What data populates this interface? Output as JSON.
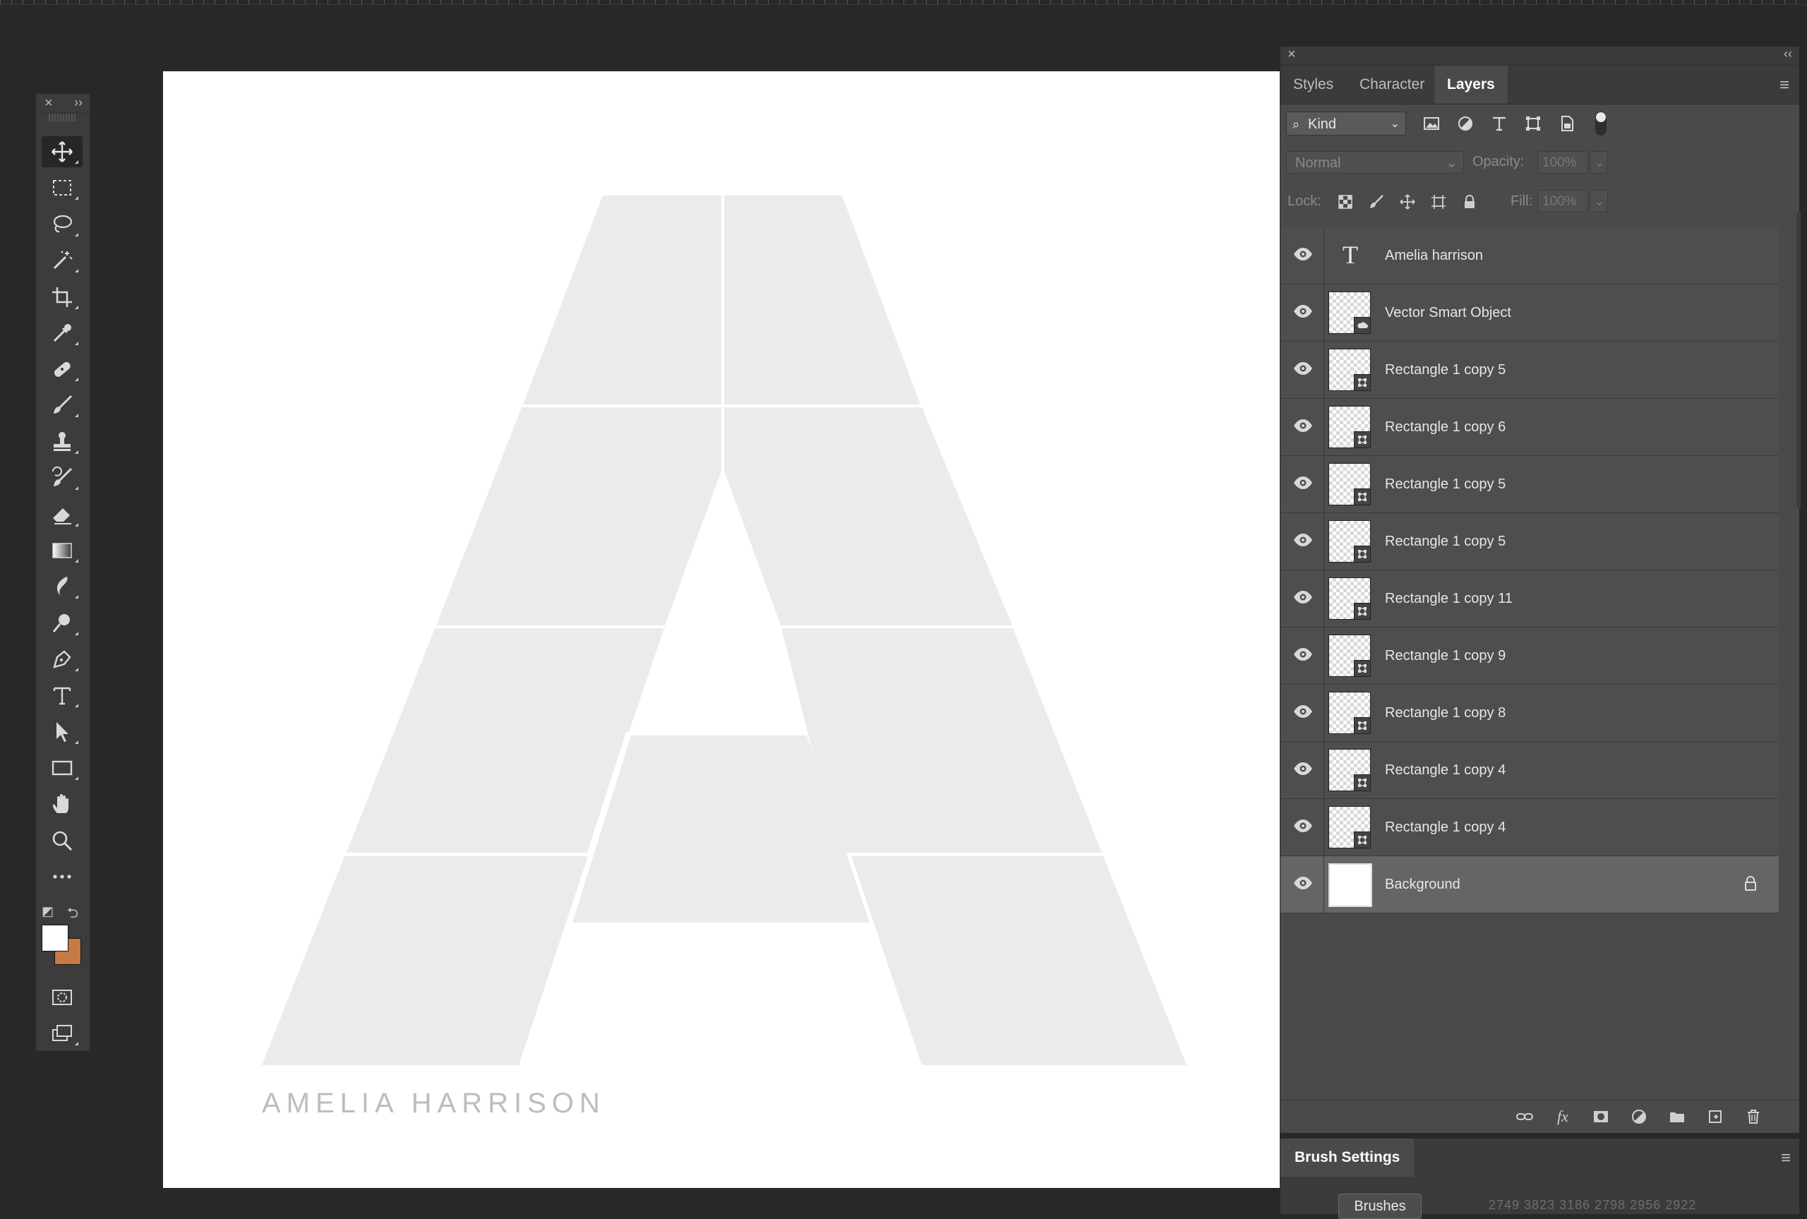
{
  "toolbar": {
    "tools": [
      {
        "name": "move-tool",
        "icon": "move-icon"
      },
      {
        "name": "marquee-tool",
        "icon": "rect-marquee-icon"
      },
      {
        "name": "lasso-tool",
        "icon": "lasso-icon"
      },
      {
        "name": "magic-wand-tool",
        "icon": "magic-wand-icon"
      },
      {
        "name": "crop-tool",
        "icon": "crop-icon"
      },
      {
        "name": "eyedropper-tool",
        "icon": "eyedropper-icon"
      },
      {
        "name": "healing-tool",
        "icon": "bandage-icon"
      },
      {
        "name": "brush-tool",
        "icon": "brush-icon"
      },
      {
        "name": "stamp-tool",
        "icon": "stamp-icon"
      },
      {
        "name": "history-brush-tool",
        "icon": "history-brush-icon"
      },
      {
        "name": "eraser-tool",
        "icon": "eraser-icon"
      },
      {
        "name": "gradient-tool",
        "icon": "gradient-icon"
      },
      {
        "name": "blur-tool",
        "icon": "blur-icon"
      },
      {
        "name": "dodge-tool",
        "icon": "dodge-icon"
      },
      {
        "name": "pen-tool",
        "icon": "pen-icon"
      },
      {
        "name": "type-tool",
        "icon": "type-icon"
      },
      {
        "name": "path-selection-tool",
        "icon": "arrow-icon"
      },
      {
        "name": "rectangle-tool",
        "icon": "rectangle-icon"
      },
      {
        "name": "hand-tool",
        "icon": "hand-icon"
      },
      {
        "name": "zoom-tool",
        "icon": "zoom-icon"
      },
      {
        "name": "more-tools",
        "icon": "ellipsis-icon"
      }
    ],
    "foreground_color": "#ffffff",
    "background_color": "#c87a44"
  },
  "canvas": {
    "caption": "AMELIA HARRISON",
    "shape_color": "#ebebeb"
  },
  "panel": {
    "tabs": [
      "Styles",
      "Character",
      "Layers"
    ],
    "active_tab": "Layers",
    "filter_kind": "Kind",
    "blend_mode": "Normal",
    "opacity_label": "Opacity:",
    "opacity_value": "100%",
    "lock_label": "Lock:",
    "fill_label": "Fill:",
    "fill_value": "100%",
    "layers": [
      {
        "name": "Amelia harrison",
        "type": "text"
      },
      {
        "name": "Vector Smart Object",
        "type": "smart"
      },
      {
        "name": "Rectangle 1 copy 5",
        "type": "shape"
      },
      {
        "name": "Rectangle 1 copy 6",
        "type": "shape"
      },
      {
        "name": "Rectangle 1 copy 5",
        "type": "shape"
      },
      {
        "name": "Rectangle 1 copy 5",
        "type": "shape"
      },
      {
        "name": "Rectangle 1 copy 11",
        "type": "shape"
      },
      {
        "name": "Rectangle 1 copy 9",
        "type": "shape"
      },
      {
        "name": "Rectangle 1 copy 8",
        "type": "shape"
      },
      {
        "name": "Rectangle 1 copy 4",
        "type": "shape"
      },
      {
        "name": "Rectangle 1 copy 4",
        "type": "shape"
      },
      {
        "name": "Background",
        "type": "background",
        "selected": true,
        "locked": true
      }
    ]
  },
  "brush_panel": {
    "tab": "Brush Settings",
    "brushes_button": "Brushes",
    "sizes": "2749  3823  3186  2798  2956  2922"
  }
}
